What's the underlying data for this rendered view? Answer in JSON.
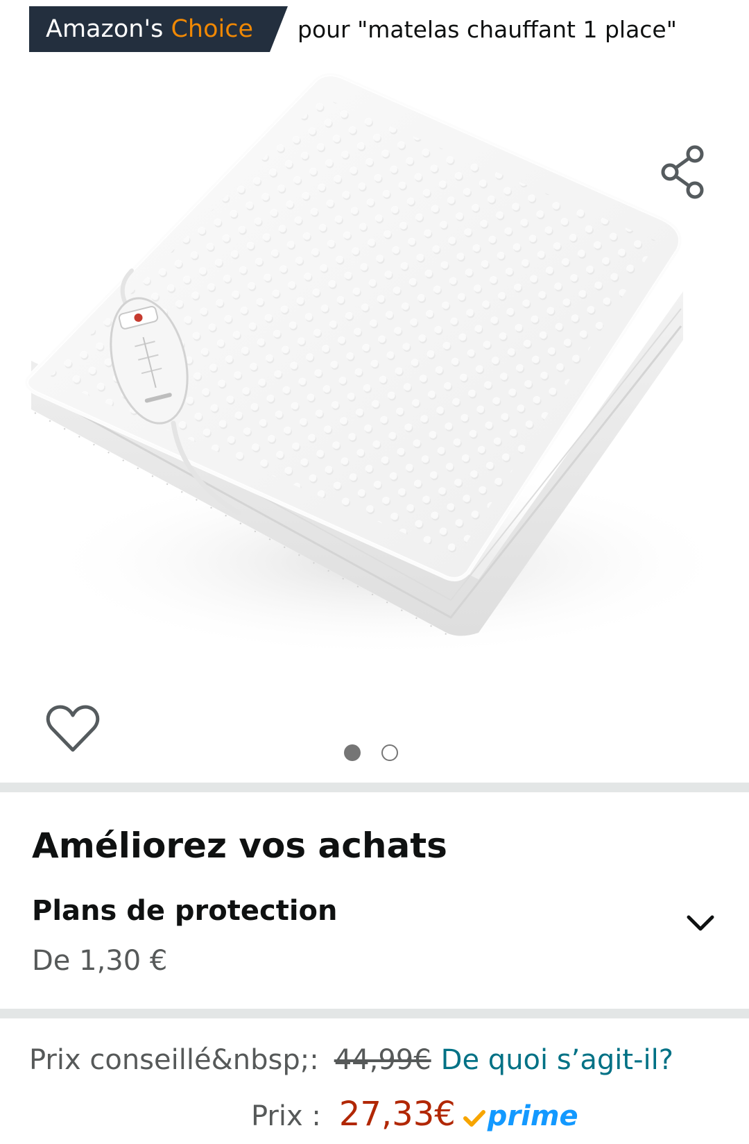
{
  "badge": {
    "brand_label": "Amazon's",
    "choice_label": "Choice",
    "context": "pour \"matelas chauffant 1 place\""
  },
  "product": {
    "icons": {
      "share": "share-icon",
      "wishlist": "heart-icon"
    },
    "carousel": {
      "total_images": 2,
      "active_index": 0
    }
  },
  "improve": {
    "title": "Améliorez vos achats",
    "protection_title": "Plans de protection",
    "protection_price": "De 1,30 €"
  },
  "pricing": {
    "list_price_label": "Prix conseillé&nbsp;:",
    "list_price_value": "44,99€",
    "whats_this_link": "De quoi s’agit-il?",
    "price_label": "Prix :",
    "price_value": "27,33€",
    "prime_label": "prime"
  },
  "colors": {
    "badge_background": "#232f3e",
    "choice_orange": "#f08804",
    "price_red": "#b12704",
    "link_teal": "#007185",
    "prime_blue": "#1399ff",
    "prime_check_orange": "#f7a500"
  }
}
